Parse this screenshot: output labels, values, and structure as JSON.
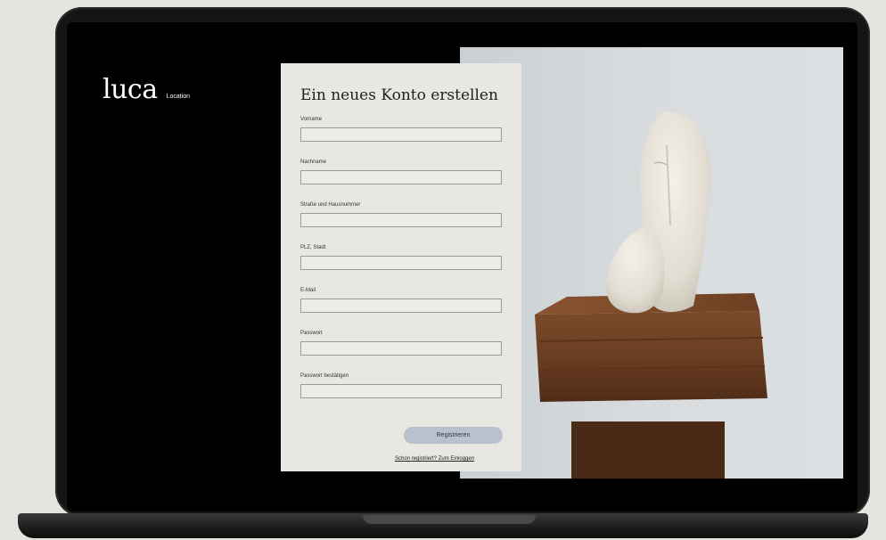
{
  "brand": {
    "logo": "luca",
    "subtitle": "Location"
  },
  "form": {
    "title": "Ein neues Konto erstellen",
    "fields": [
      {
        "label": "Vorname",
        "value": ""
      },
      {
        "label": "Nachname",
        "value": ""
      },
      {
        "label": "Straße und Hausnummer",
        "value": ""
      },
      {
        "label": "PLZ, Stadt",
        "value": ""
      },
      {
        "label": "E-Mail",
        "value": ""
      },
      {
        "label": "Passwort",
        "value": ""
      },
      {
        "label": "Passwort bestätigen",
        "value": ""
      }
    ],
    "submit_label": "Registrieren",
    "login_link": "Schon registriert? Zum Einloggen"
  },
  "colors": {
    "screen_bg": "#000000",
    "form_bg": "#e8e7e2",
    "button_bg": "#b9c1cf"
  },
  "image": {
    "subject": "sculpture-photo"
  }
}
